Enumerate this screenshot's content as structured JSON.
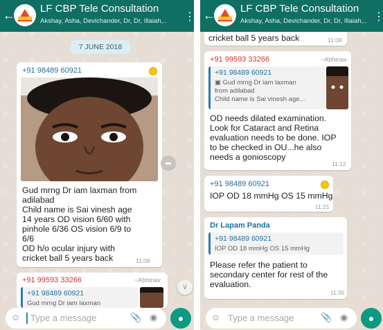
{
  "header": {
    "title": "LF CBP Tele Consultation",
    "subtitle": "Akshay, Asha, Devichander, Dr, Dr, Illaiah,..",
    "back_icon": "arrow-left",
    "menu_icon": "kebab"
  },
  "left": {
    "date": "7 JUNE 2018",
    "msg1": {
      "sender": "+91 98489 60921",
      "lines": [
        "Gud mrng Dr iam laxman from",
        "adilabad",
        "Child name is Sai vinesh age",
        "14 years OD vision 6/60 with",
        "pinhole 6/36 OS vision 6/9 to",
        "6/6",
        "OD h/o ocular injury with",
        "cricket ball 5 years back"
      ],
      "time": "11:08"
    },
    "msg2": {
      "sender": "+91 99593 33266",
      "tilde": "~Abhinav",
      "quote_sender": "+91 98489 60921",
      "quote_text": "Gud mrng Dr iam laxman"
    },
    "input_placeholder": "Type a message"
  },
  "right": {
    "top_line": "cricket ball 5 years back",
    "top_time": "11:08",
    "msg1": {
      "sender": "+91 99593 33266",
      "tilde": "~Abhinav",
      "quote_sender": "+91 98489 60921",
      "quote_lines": [
        "Gud mrng Dr iam laxman",
        "from adilabad",
        "Child name is Sai vinesh age..."
      ],
      "lines": [
        "OD needs dilated examination.",
        "Look for Cataract and Retina",
        "evaluation needs to be done. IOP",
        "to be checked in OU...he also",
        "needs a gonioscopy"
      ],
      "time": "11:12"
    },
    "msg2": {
      "sender": "+91 98489 60921",
      "text": "IOP OD 18 mmHg OS 15 mmHg",
      "time": "11:21"
    },
    "msg3": {
      "sender": "Dr Lapam Panda",
      "quote_sender": "+91 98489 60921",
      "quote_text": "IOP OD 18 mmHg OS 15 mmHg",
      "lines": [
        "Please refer the patient to",
        "secondary center for rest of the",
        "evaluation."
      ],
      "time": "11:35"
    },
    "input_placeholder": "Type a message"
  },
  "colors": {
    "header": "#0f6f63",
    "chat_bg": "#e6ddd4",
    "send_button": "#0c9a82"
  }
}
